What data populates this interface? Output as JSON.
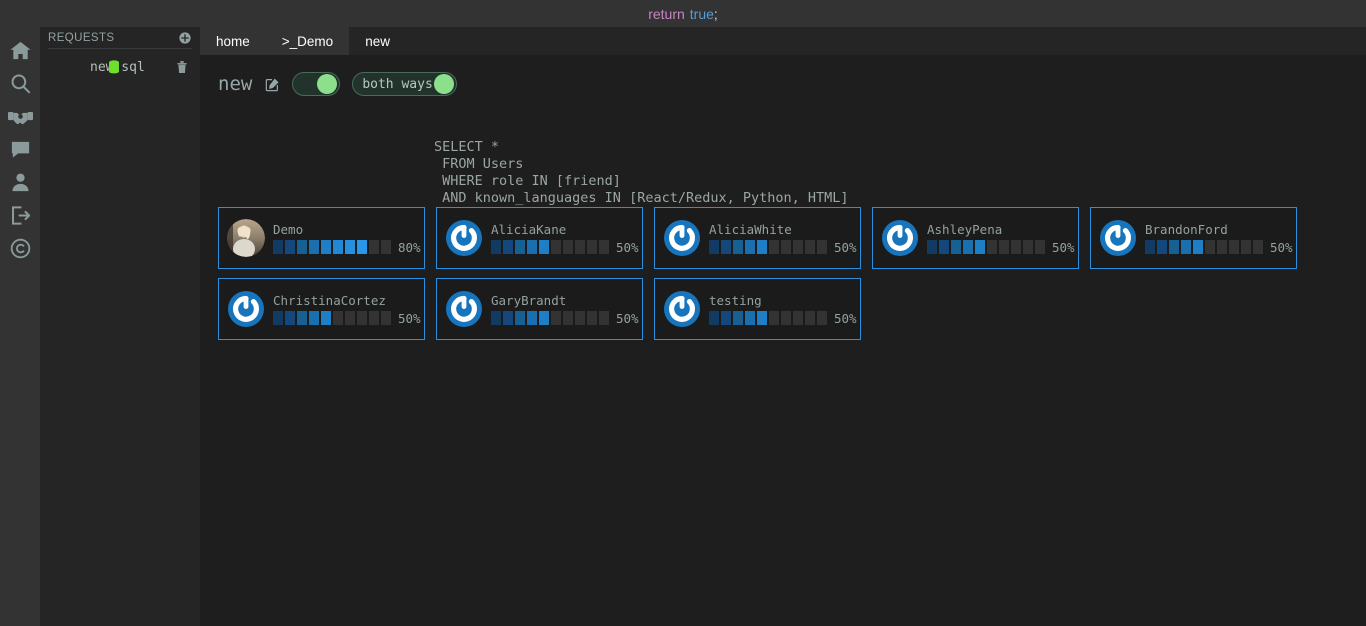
{
  "titlebar": {
    "keyword": "return",
    "value": "true",
    "punctuation": ";"
  },
  "rail": {
    "items": [
      {
        "icon": "home-icon",
        "name": "rail-item-home"
      },
      {
        "icon": "search-icon",
        "name": "rail-item-search"
      },
      {
        "icon": "handshake-icon",
        "name": "rail-item-partners"
      },
      {
        "icon": "chat-icon",
        "name": "rail-item-messages"
      },
      {
        "icon": "user-icon",
        "name": "rail-item-profile"
      },
      {
        "icon": "logout-icon",
        "name": "rail-item-logout"
      },
      {
        "icon": "copyright-icon",
        "name": "rail-item-copyright"
      }
    ]
  },
  "requests": {
    "title": "REQUESTS",
    "add_icon": "plus-circle-icon",
    "files": [
      {
        "name": "new.sql",
        "file_icon": "database-icon",
        "delete_icon": "trash-icon"
      }
    ]
  },
  "tabs": [
    {
      "label": "home",
      "active": true
    },
    {
      "label": ">_Demo",
      "active": true
    },
    {
      "label": "new",
      "active": false
    }
  ],
  "document": {
    "title": "new",
    "edit_icon": "edit-square-icon",
    "toggle_primary": {
      "label": "",
      "on": true
    },
    "toggle_direction": {
      "label": "both ways",
      "on": true
    }
  },
  "query": {
    "lines": [
      "SELECT *",
      " FROM Users",
      " WHERE role IN [friend]",
      " AND known_languages IN [React/Redux, Python, HTML]"
    ]
  },
  "results": {
    "segments_total": 10,
    "cards": [
      {
        "name": "Demo",
        "percent": 80,
        "percent_label": "80%",
        "avatar": "photo-avatar"
      },
      {
        "name": "AliciaKane",
        "percent": 50,
        "percent_label": "50%",
        "avatar": "power-icon"
      },
      {
        "name": "AliciaWhite",
        "percent": 50,
        "percent_label": "50%",
        "avatar": "power-icon"
      },
      {
        "name": "AshleyPena",
        "percent": 50,
        "percent_label": "50%",
        "avatar": "power-icon"
      },
      {
        "name": "BrandonFord",
        "percent": 50,
        "percent_label": "50%",
        "avatar": "power-icon"
      },
      {
        "name": "ChristinaCortez",
        "percent": 50,
        "percent_label": "50%",
        "avatar": "power-icon"
      },
      {
        "name": "GaryBrandt",
        "percent": 50,
        "percent_label": "50%",
        "avatar": "power-icon"
      },
      {
        "name": "testing",
        "percent": 50,
        "percent_label": "50%",
        "avatar": "power-icon"
      }
    ]
  },
  "colors": {
    "accent_blue": "#2b8fe0",
    "toggle_green": "#8ce08c",
    "db_green": "#6ee02b",
    "panel_bg": "#252526",
    "rail_bg": "#333333",
    "main_bg": "#1e1e1e",
    "text_muted": "#93a1a1",
    "meter_empty": "#333333"
  }
}
